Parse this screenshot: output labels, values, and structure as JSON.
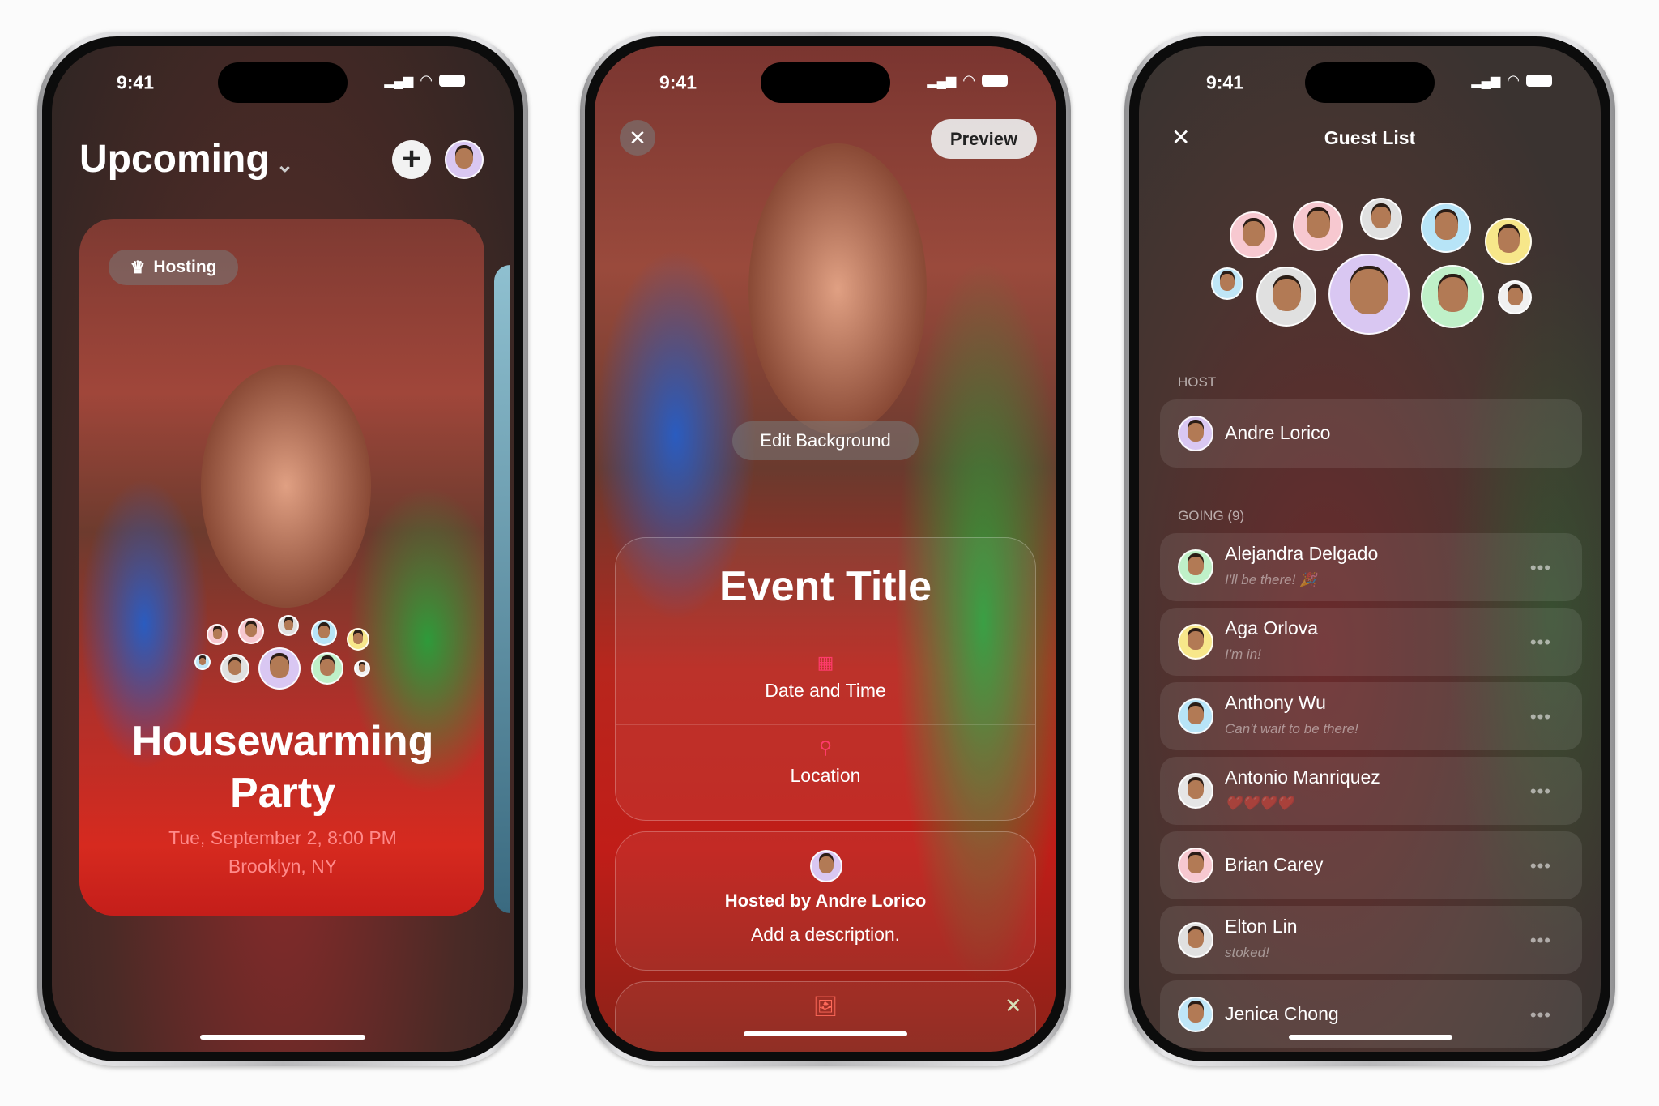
{
  "status_time": "9:41",
  "upcoming": {
    "title": "Upcoming",
    "badge": "Hosting",
    "event_title": "Housewarming Party",
    "date": "Tue, September 2, 8:00 PM",
    "location": "Brooklyn, NY",
    "accent": "#ff8a8a"
  },
  "editor": {
    "preview_label": "Preview",
    "edit_background_label": "Edit Background",
    "event_title_placeholder": "Event Title",
    "date_time_label": "Date and Time",
    "location_label": "Location",
    "hosted_by": "Hosted by Andre Lorico",
    "description_placeholder": "Add a description.",
    "accent": "#ff3b6b"
  },
  "guest_list": {
    "title": "Guest List",
    "host_section": "HOST",
    "host_name": "Andre Lorico",
    "going_section": "GOING (9)",
    "guests": [
      {
        "name": "Alejandra Delgado",
        "status": "I'll be there! 🎉",
        "avatar_color": "#bff0c8"
      },
      {
        "name": "Aga Orlova",
        "status": "I'm in!",
        "avatar_color": "#f7e78a"
      },
      {
        "name": "Anthony Wu",
        "status": "Can't wait to be there!",
        "avatar_color": "#b7e4f7"
      },
      {
        "name": "Antonio Manriquez",
        "status": "❤️❤️❤️❤️",
        "avatar_color": "#e5e5e5"
      },
      {
        "name": "Brian Carey",
        "status": "",
        "avatar_color": "#f7c8d0"
      },
      {
        "name": "Elton Lin",
        "status": "stoked!",
        "avatar_color": "#e0e0e0"
      },
      {
        "name": "Jenica Chong",
        "status": "",
        "avatar_color": "#bfe6f7"
      }
    ]
  }
}
